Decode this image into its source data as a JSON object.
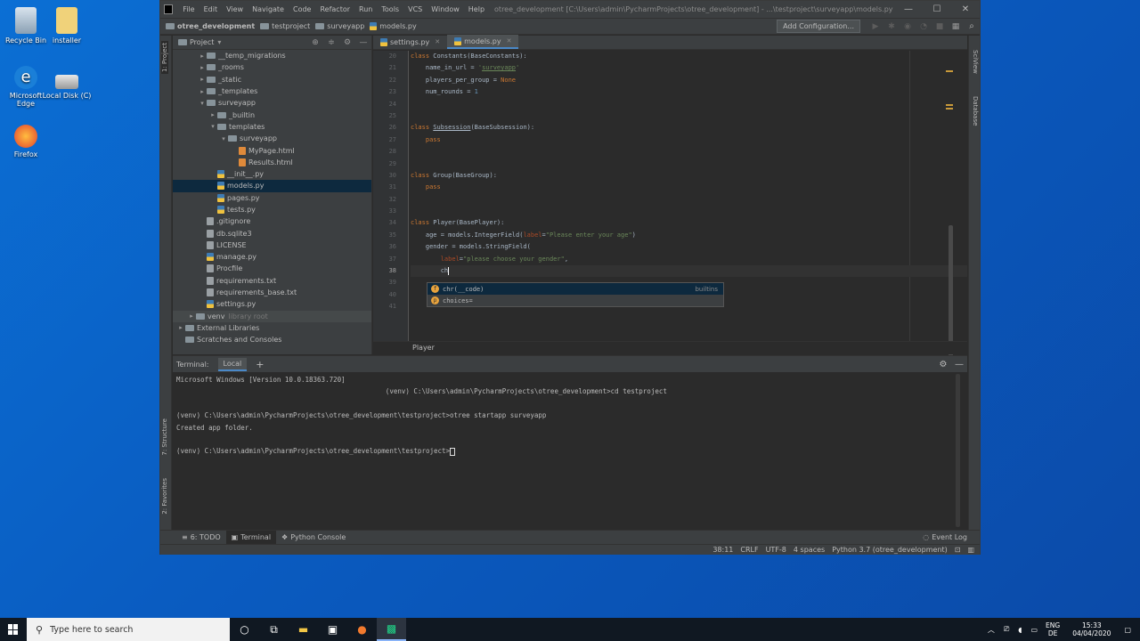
{
  "desktop": {
    "icons": [
      {
        "name": "recycle-bin-icon",
        "label": "Recycle Bin"
      },
      {
        "name": "installer-icon",
        "label": "installer"
      },
      {
        "name": "edge-icon",
        "label": "Microsoft Edge"
      },
      {
        "name": "local-disk-icon",
        "label": "Local Disk (C)"
      },
      {
        "name": "firefox-icon",
        "label": "Firefox"
      }
    ]
  },
  "ide": {
    "menu": [
      "File",
      "Edit",
      "View",
      "Navigate",
      "Code",
      "Refactor",
      "Run",
      "Tools",
      "VCS",
      "Window",
      "Help"
    ],
    "window_title": "otree_development [C:\\Users\\admin\\PycharmProjects\\otree_development] - ...\\testproject\\surveyapp\\models.py - PyCharm",
    "nav_crumbs": [
      "otree_development",
      "testproject",
      "surveyapp",
      "models.py"
    ],
    "add_config": "Add Configuration...",
    "left_tabs": [
      "1: Project",
      "7: Structure",
      "2: Favorites"
    ],
    "right_tabs": [
      "SciView",
      "Database"
    ],
    "project": {
      "title": "Project",
      "tree": [
        {
          "label": "__temp_migrations",
          "depth": 2,
          "type": "folder",
          "arrow": "▸"
        },
        {
          "label": "_rooms",
          "depth": 2,
          "type": "folder",
          "arrow": "▸"
        },
        {
          "label": "_static",
          "depth": 2,
          "type": "folder",
          "arrow": "▸"
        },
        {
          "label": "_templates",
          "depth": 2,
          "type": "folder",
          "arrow": "▸"
        },
        {
          "label": "surveyapp",
          "depth": 2,
          "type": "folder",
          "arrow": "▾"
        },
        {
          "label": "_builtin",
          "depth": 3,
          "type": "folder",
          "arrow": "▸"
        },
        {
          "label": "templates",
          "depth": 3,
          "type": "folder",
          "arrow": "▾"
        },
        {
          "label": "surveyapp",
          "depth": 4,
          "type": "folder",
          "arrow": "▾"
        },
        {
          "label": "MyPage.html",
          "depth": 5,
          "type": "html",
          "arrow": ""
        },
        {
          "label": "Results.html",
          "depth": 5,
          "type": "html",
          "arrow": ""
        },
        {
          "label": "__init__.py",
          "depth": 3,
          "type": "py",
          "arrow": ""
        },
        {
          "label": "models.py",
          "depth": 3,
          "type": "py",
          "arrow": "",
          "selected": true
        },
        {
          "label": "pages.py",
          "depth": 3,
          "type": "py",
          "arrow": ""
        },
        {
          "label": "tests.py",
          "depth": 3,
          "type": "py",
          "arrow": ""
        },
        {
          "label": ".gitignore",
          "depth": 2,
          "type": "txt",
          "arrow": ""
        },
        {
          "label": "db.sqlite3",
          "depth": 2,
          "type": "txt",
          "arrow": ""
        },
        {
          "label": "LICENSE",
          "depth": 2,
          "type": "txt",
          "arrow": ""
        },
        {
          "label": "manage.py",
          "depth": 2,
          "type": "py",
          "arrow": ""
        },
        {
          "label": "Procfile",
          "depth": 2,
          "type": "txt",
          "arrow": ""
        },
        {
          "label": "requirements.txt",
          "depth": 2,
          "type": "txt",
          "arrow": ""
        },
        {
          "label": "requirements_base.txt",
          "depth": 2,
          "type": "txt",
          "arrow": ""
        },
        {
          "label": "settings.py",
          "depth": 2,
          "type": "py",
          "arrow": ""
        },
        {
          "label": "venv",
          "depth": 1,
          "type": "folder",
          "arrow": "▸",
          "suffix": "library root",
          "shaded": true
        },
        {
          "label": "External Libraries",
          "depth": 0,
          "type": "folder",
          "arrow": "▸"
        },
        {
          "label": "Scratches and Consoles",
          "depth": 0,
          "type": "folder",
          "arrow": ""
        }
      ]
    },
    "tabs": [
      {
        "label": "settings.py",
        "active": false
      },
      {
        "label": "models.py",
        "active": true
      }
    ],
    "editor": {
      "line_numbers": [
        "20",
        "21",
        "22",
        "23",
        "24",
        "25",
        "26",
        "27",
        "28",
        "29",
        "30",
        "31",
        "32",
        "33",
        "34",
        "35",
        "36",
        "37",
        "38",
        "39",
        "40",
        "41"
      ],
      "current_line": "38",
      "completion": [
        {
          "text": "chr(__code)",
          "source": "builtins",
          "selected": true
        },
        {
          "text": "choices=",
          "source": "",
          "selected": false
        }
      ],
      "breadcrumb": "Player"
    },
    "terminal": {
      "label": "Terminal:",
      "tab": "Local",
      "lines": [
        "Microsoft Windows [Version 10.0.18363.720]",
        "                                                    (venv) C:\\Users\\admin\\PycharmProjects\\otree_development>cd testproject",
        "",
        "(venv) C:\\Users\\admin\\PycharmProjects\\otree_development\\testproject>otree startapp surveyapp",
        "Created app folder.",
        "",
        "(venv) C:\\Users\\admin\\PycharmProjects\\otree_development\\testproject>"
      ]
    },
    "tool_windows": [
      "6: TODO",
      "Terminal",
      "Python Console"
    ],
    "event_log": "Event Log",
    "status": [
      "38:11",
      "CRLF",
      "UTF-8",
      "4 spaces",
      "Python 3.7 (otree_development)"
    ]
  },
  "taskbar": {
    "search_placeholder": "Type here to search",
    "lang": "ENG",
    "layout": "DE",
    "time": "15:33",
    "date": "04/04/2020"
  }
}
